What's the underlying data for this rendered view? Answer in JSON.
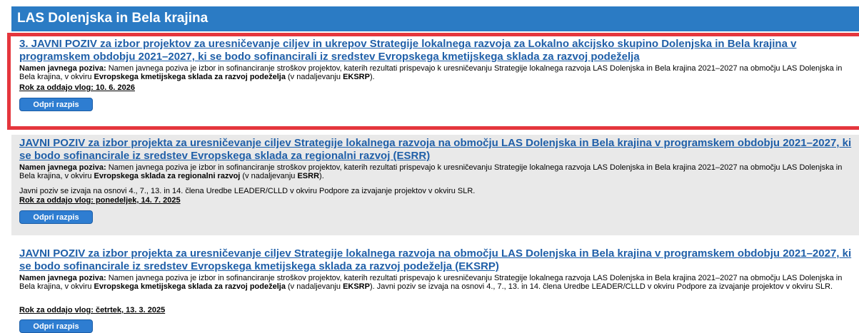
{
  "header": {
    "title": "LAS Dolenjska in Bela krajina"
  },
  "calls": [
    {
      "title": "3. JAVNI POZIV za izbor projektov za uresničevanje ciljev in ukrepov Strategije lokalnega razvoja za Lokalno akcijsko skupino Dolenjska in Bela krajina v programskem obdobju 2021–2027, ki se bodo sofinancirali iz sredstev Evropskega kmetijskega sklada za razvoj podeželja",
      "desc_label": "Namen javnega poziva:",
      "desc_text": " Namen javnega poziva je izbor in sofinanciranje stroškov projektov, katerih rezultati prispevajo k uresničevanju Strategije lokalnega razvoja LAS Dolenjska in Bela krajina 2021–2027 na območju LAS Dolenjska in Bela krajina, v okviru ",
      "fund_name": "Evropskega kmetijskega sklada za razvoj podeželja",
      "fund_suffix_pre": " (v nadaljevanju ",
      "fund_abbr": "EKSRP",
      "fund_suffix_post": ").",
      "extra": "",
      "deadline": "Rok za oddajo vlog: 10. 6. 2026",
      "button": "Odpri razpis"
    },
    {
      "title": "JAVNI POZIV za izbor projekta za uresničevanje ciljev Strategije lokalnega razvoja na območju LAS Dolenjska in Bela krajina v programskem obdobju 2021–2027, ki se bodo sofinancirale iz sredstev Evropskega sklada za regionalni razvoj (ESRR)",
      "desc_label": "Namen javnega poziva:",
      "desc_text": " Namen javnega poziva je izbor in sofinanciranje stroškov projektov, katerih rezultati prispevajo k uresničevanju Strategije lokalnega razvoja LAS Dolenjska in Bela krajina 2021–2027 na območju LAS Dolenjska in Bela krajina, v okviru ",
      "fund_name": "Evropskega sklada za regionalni razvoj",
      "fund_suffix_pre": " (v nadaljevanju ",
      "fund_abbr": "ESRR",
      "fund_suffix_post": ").",
      "extra": "Javni poziv se izvaja na osnovi 4., 7., 13. in 14. člena Uredbe LEADER/CLLD v okviru Podpore za izvajanje projektov v okviru SLR.",
      "deadline": "Rok za oddajo vlog: ponedeljek, 14. 7. 2025",
      "button": "Odpri razpis"
    },
    {
      "title": "JAVNI POZIV za izbor projekta za uresničevanje ciljev Strategije lokalnega razvoja na območju LAS Dolenjska in Bela krajina v programskem obdobju 2021–2027, ki se bodo sofinancirale iz sredstev Evropskega kmetijskega sklada za razvoj podeželja (EKSRP)",
      "desc_label": "Namen javnega poziva:",
      "desc_text": " Namen javnega poziva je izbor in sofinanciranje stroškov projektov, katerih rezultati prispevajo k uresničevanju Strategije lokalnega razvoja LAS Dolenjska in Bela krajina 2021–2027 na območju LAS Dolenjska in Bela krajina, v okviru ",
      "fund_name": "Evropskega kmetijskega sklada za razvoj podeželja",
      "fund_suffix_pre": " (v nadaljevanju ",
      "fund_abbr": "EKSRP",
      "fund_suffix_post": "). Javni poziv se izvaja na osnovi 4., 7., 13. in 14. člena Uredbe LEADER/CLLD v okviru Podpore za izvajanje projektov v okviru SLR.",
      "extra": "",
      "deadline": "Rok za oddajo vlog: četrtek, 13. 3. 2025",
      "button": "Odpri razpis"
    }
  ]
}
